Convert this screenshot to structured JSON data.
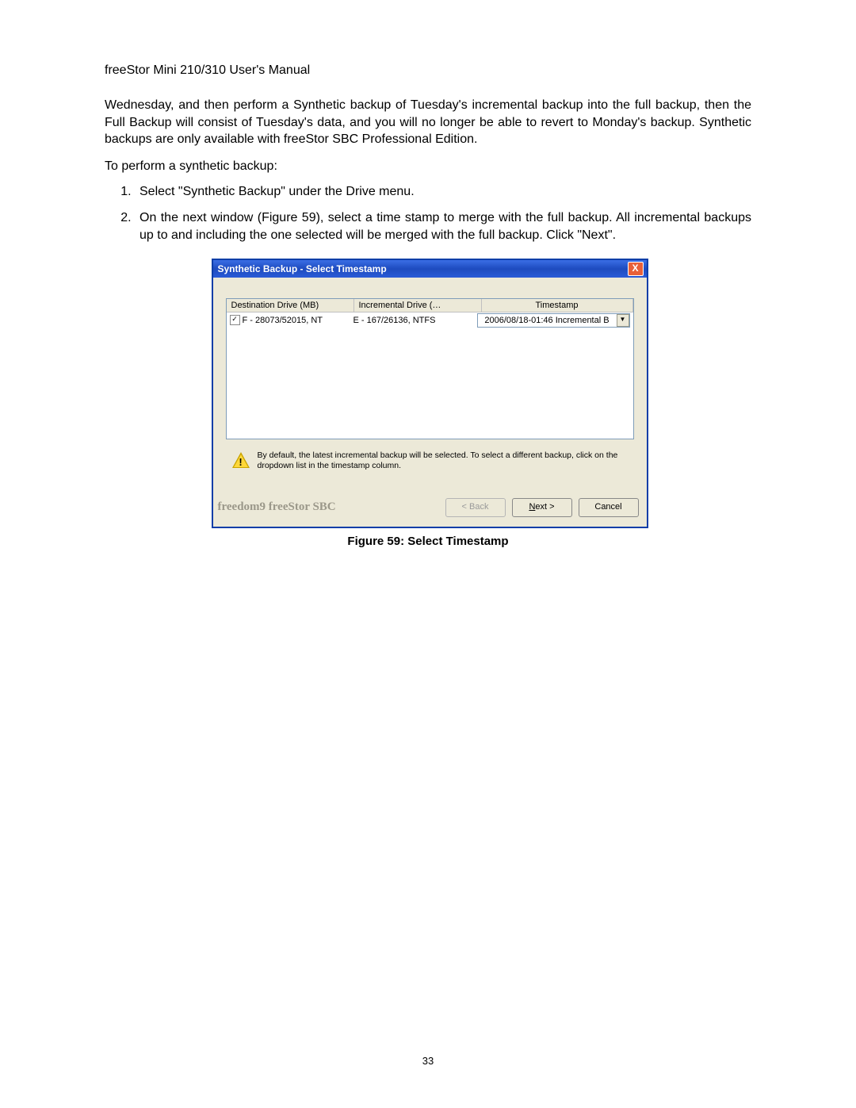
{
  "doc": {
    "header": "freeStor Mini 210/310 User's Manual",
    "para1": "Wednesday, and then perform a Synthetic backup of Tuesday's incremental backup into the full backup, then the Full Backup will consist of Tuesday's data, and you will no longer be able to revert to Monday's backup.  Synthetic backups are only available with freeStor SBC Professional Edition.",
    "instr": "To perform a synthetic backup:",
    "step1": "Select \"Synthetic Backup\" under the Drive menu.",
    "step2": "On the next window (Figure 59), select a time stamp to merge with the full backup.  All incremental backups up to and including the one selected will be merged with the full backup.  Click \"Next\".",
    "caption": "Figure 59: Select Timestamp",
    "page": "33"
  },
  "dlg": {
    "title": "Synthetic Backup - Select Timestamp",
    "close": "X",
    "colA": "Destination Drive (MB)",
    "colB": "Incremental Drive (…",
    "colC": "Timestamp",
    "row": {
      "dest": "F - 28073/52015, NT",
      "inc": "E - 167/26136, NTFS",
      "ts": "2006/08/18-01:46 Incremental B"
    },
    "hint": "By default, the latest incremental backup will be selected. To select a different backup, click on the dropdown list in the timestamp column.",
    "brand": "freedom9 freeStor SBC",
    "back": "< Back",
    "nextPre": "N",
    "nextPost": "ext >",
    "cancel": "Cancel"
  }
}
